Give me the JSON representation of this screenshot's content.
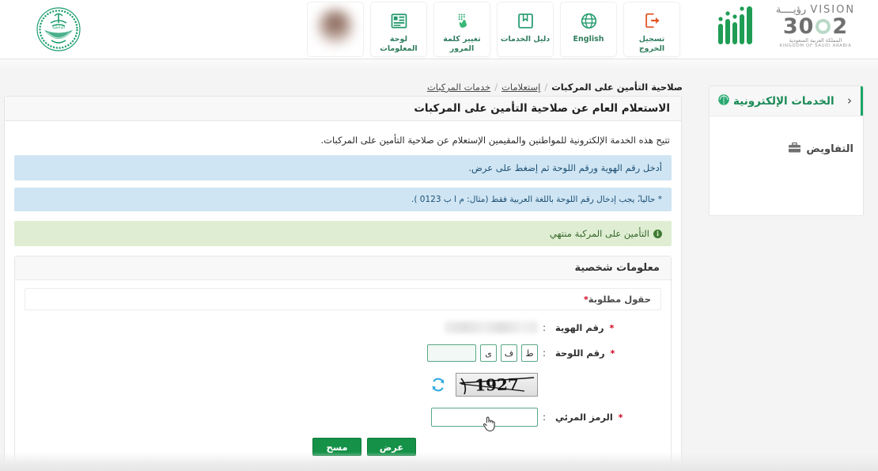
{
  "header": {
    "moi_emblem_alt": "moi-emblem",
    "nav_tiles": [
      {
        "label": "تسجيل الخروج",
        "icon": "logout-icon",
        "name": "logout"
      },
      {
        "label": "English",
        "icon": "globe-icon",
        "name": "language"
      },
      {
        "label": "دليل الخدمات",
        "icon": "book-icon",
        "name": "services-guide"
      },
      {
        "label": "تغيير كلمة المرور",
        "icon": "keypad-hand-icon",
        "name": "change-password"
      },
      {
        "label": "لوحة المعلومات",
        "icon": "dashboard-icon",
        "name": "dashboard"
      }
    ],
    "vision": {
      "word_en": "VISION",
      "word_ar": "رؤيــــة",
      "number_left": "2",
      "number_right": "30",
      "sub_ar": "المملكة العربية السعودية",
      "sub_en": "KINGDOM OF SAUDI ARABIA"
    },
    "absher_alt": "absher-logo"
  },
  "breadcrumb": {
    "items": [
      {
        "label": "خدمات المركبات",
        "current": false
      },
      {
        "label": "إستعلامات",
        "current": false
      },
      {
        "label": "صلاحية التأمين على المركبات",
        "current": true
      }
    ],
    "separator": "/"
  },
  "sidebar": {
    "title": "الخدمات الإلكترونية",
    "back_chevron": "‹",
    "items": [
      {
        "label": "التفاويض",
        "icon": "briefcase-icon"
      }
    ]
  },
  "main": {
    "card_title": "الاستعلام العام عن صلاحية التأمين على المركبات",
    "intro": "تتيح هذه الخدمة الإلكترونية للمواطنين والمقيمين الإستعلام عن صلاحية التأمين على المركبات.",
    "alerts": [
      {
        "type": "info",
        "text": "أدخل رقم الهوية ورقم اللوحة ثم إضغط على عرض."
      },
      {
        "type": "info",
        "text": "* حاليا،ً يجب إدخال رقم اللوحة باللغة العربية فقط (مثال: م ا ب 0123 )."
      },
      {
        "type": "success",
        "text": "التأمين على المركبة منتهي"
      }
    ],
    "panel": {
      "title": "معلومات شخصية",
      "required_note": "حقول مطلوبة",
      "required_star": "*",
      "fields": {
        "id_number": {
          "label": "رقم الهوية",
          "colon": ":",
          "value": "",
          "redacted": true
        },
        "plate_number": {
          "label": "رقم اللوحة",
          "colon": ":",
          "digits": "",
          "letters": [
            "ط",
            "ف",
            "ى"
          ]
        },
        "visual_code": {
          "label": "الرمز المرئي",
          "colon": ":",
          "value": ""
        }
      },
      "captcha": {
        "text": "1927",
        "refresh_icon": "refresh-icon"
      },
      "buttons": [
        {
          "label": "عرض",
          "name": "submit"
        },
        {
          "label": "مسح",
          "name": "clear"
        }
      ]
    }
  },
  "colors": {
    "brand_green": "#159148",
    "sidebar_green": "#1b8a57",
    "accent_green": "#19a463",
    "info_bg": "#cfe5f3",
    "success_bg": "#dfeed3",
    "required_red": "#d0021b",
    "page_bg": "#f4f4f4"
  }
}
